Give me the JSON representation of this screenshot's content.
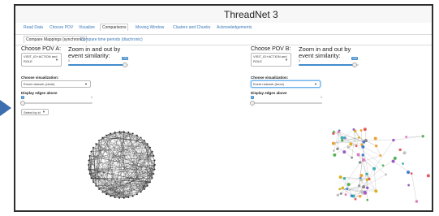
{
  "app": {
    "title": "ThreadNet 3"
  },
  "nav": {
    "tabs": [
      {
        "label": "Read Data"
      },
      {
        "label": "Choose POV"
      },
      {
        "label": "Visualize"
      },
      {
        "label": "Comparisons"
      },
      {
        "label": "Moving Window"
      },
      {
        "label": "Clusters and Chunks"
      },
      {
        "label": "Acknowledgements"
      }
    ],
    "active_index": 3
  },
  "subnav": {
    "tabs": [
      {
        "label": "Compare Mappings (synchronic)"
      },
      {
        "label": "Compare time periods (diachronic)"
      }
    ]
  },
  "panel_a": {
    "pov_label": "Choose POV A:",
    "pov_value": "VISIT_ID+ACTION and ROLE",
    "zoom_label": "Zoom in and out by event similarity:",
    "zoom_min": "0",
    "zoom_value": "100",
    "viz_label": "Choose visualization:",
    "viz_value": "Event network (circle)",
    "edges_label": "Display edges above",
    "edges_min": "0",
    "edges_max": "1",
    "edges_value": "0",
    "select_by": "Select by id"
  },
  "panel_b": {
    "pov_label": "Choose POV B:",
    "pov_value": "VISIT_ID+ACTION and ROLE",
    "zoom_label": "Zoom in and out by event similarity:",
    "zoom_min": "0",
    "zoom_value": "100",
    "viz_label": "Choose visualization:",
    "viz_value": "Event network (force)",
    "edges_label": "Display edges above",
    "edges_min": "0",
    "edges_max": "1",
    "edges_value": "0"
  },
  "icons": {
    "pointer": "right-arrow-icon",
    "dropdown": "caret-down-icon"
  },
  "colors": {
    "accent": "#428bca",
    "pointer": "#3d6fb0",
    "link": "#3a79b8"
  }
}
